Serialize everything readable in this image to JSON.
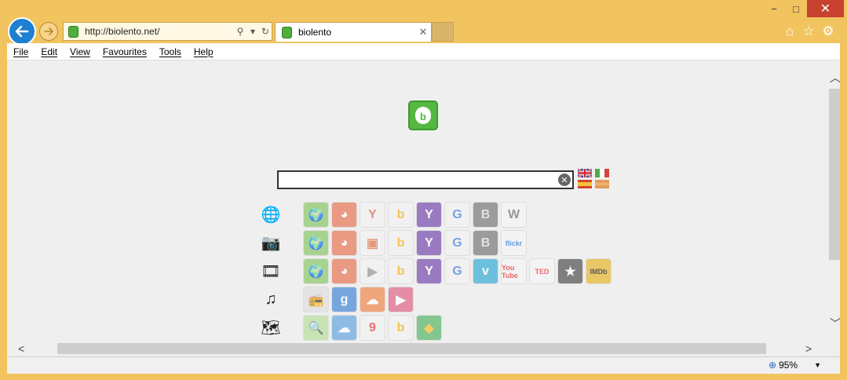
{
  "window": {
    "minimize": "−",
    "maximize": "□",
    "close": "✕"
  },
  "address_bar": {
    "url": "http://biolento.net/"
  },
  "tab": {
    "title": "biolento"
  },
  "menu": [
    "File",
    "Edit",
    "View",
    "Favourites",
    "Tools",
    "Help"
  ],
  "search": {
    "value": ""
  },
  "status": {
    "zoom": "95%"
  },
  "categories": [
    {
      "name": "web",
      "icon": "globe-icon",
      "tiles": [
        "globe",
        "duckduckgo",
        "yandex",
        "bing",
        "yahoo",
        "google",
        "blekko",
        "wikipedia"
      ]
    },
    {
      "name": "images",
      "icon": "camera-icon",
      "tiles": [
        "globe",
        "duckduckgo",
        "image",
        "bing",
        "yahoo",
        "google",
        "blekko",
        "flickr"
      ]
    },
    {
      "name": "video",
      "icon": "film-icon",
      "tiles": [
        "globe",
        "duckduckgo",
        "video",
        "bing",
        "yahoo",
        "google",
        "vimeo",
        "youtube",
        "ted",
        "star",
        "imdb"
      ]
    },
    {
      "name": "music",
      "icon": "music-icon",
      "tiles": [
        "radio",
        "grooveshark",
        "soundcloud",
        "play"
      ]
    },
    {
      "name": "maps",
      "icon": "map-icon",
      "tiles": [
        "mapsearch",
        "weather",
        "yandexmaps",
        "bing",
        "googlemaps"
      ]
    }
  ],
  "tile_labels": {
    "yandex": "Y",
    "yahoo": "Y",
    "google": "G",
    "blekko": "B",
    "wikipedia": "W",
    "flickr": "flickr",
    "vimeo": "v",
    "youtube": "You Tube",
    "ted": "TED",
    "star": "★",
    "imdb": "IMDb",
    "grooveshark": "g"
  },
  "colors": {
    "frame": "#f2c460",
    "accent_blue": "#1f7fd1",
    "logo_green": "#55b843"
  }
}
